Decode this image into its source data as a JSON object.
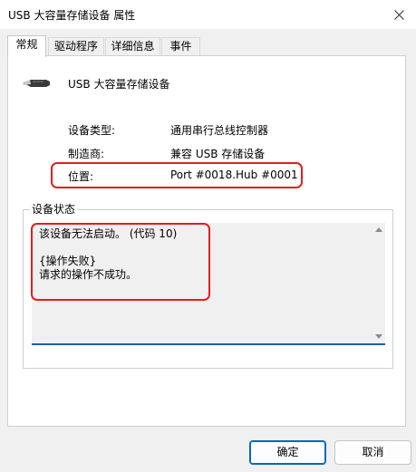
{
  "window": {
    "title": "USB 大容量存储设备 属性",
    "close_glyph": "✕"
  },
  "tabs": [
    {
      "label": "常规",
      "active": true
    },
    {
      "label": "驱动程序",
      "active": false
    },
    {
      "label": "详细信息",
      "active": false
    },
    {
      "label": "事件",
      "active": false
    }
  ],
  "device": {
    "name": "USB 大容量存储设备",
    "icon": "usb-plug-icon",
    "properties": [
      {
        "label": "设备类型:",
        "value": "通用串行总线控制器"
      },
      {
        "label": "制造商:",
        "value": "兼容 USB 存储设备"
      },
      {
        "label": "位置:",
        "value": "Port #0018.Hub #0001"
      }
    ]
  },
  "status": {
    "group_title": "设备状态",
    "text": "该设备无法启动。 (代码 10)\n\n{操作失败}\n请求的操作不成功。"
  },
  "buttons": {
    "ok": "确定",
    "cancel": "取消"
  },
  "colors": {
    "highlight": "#e0201c",
    "accent": "#0067c0"
  }
}
